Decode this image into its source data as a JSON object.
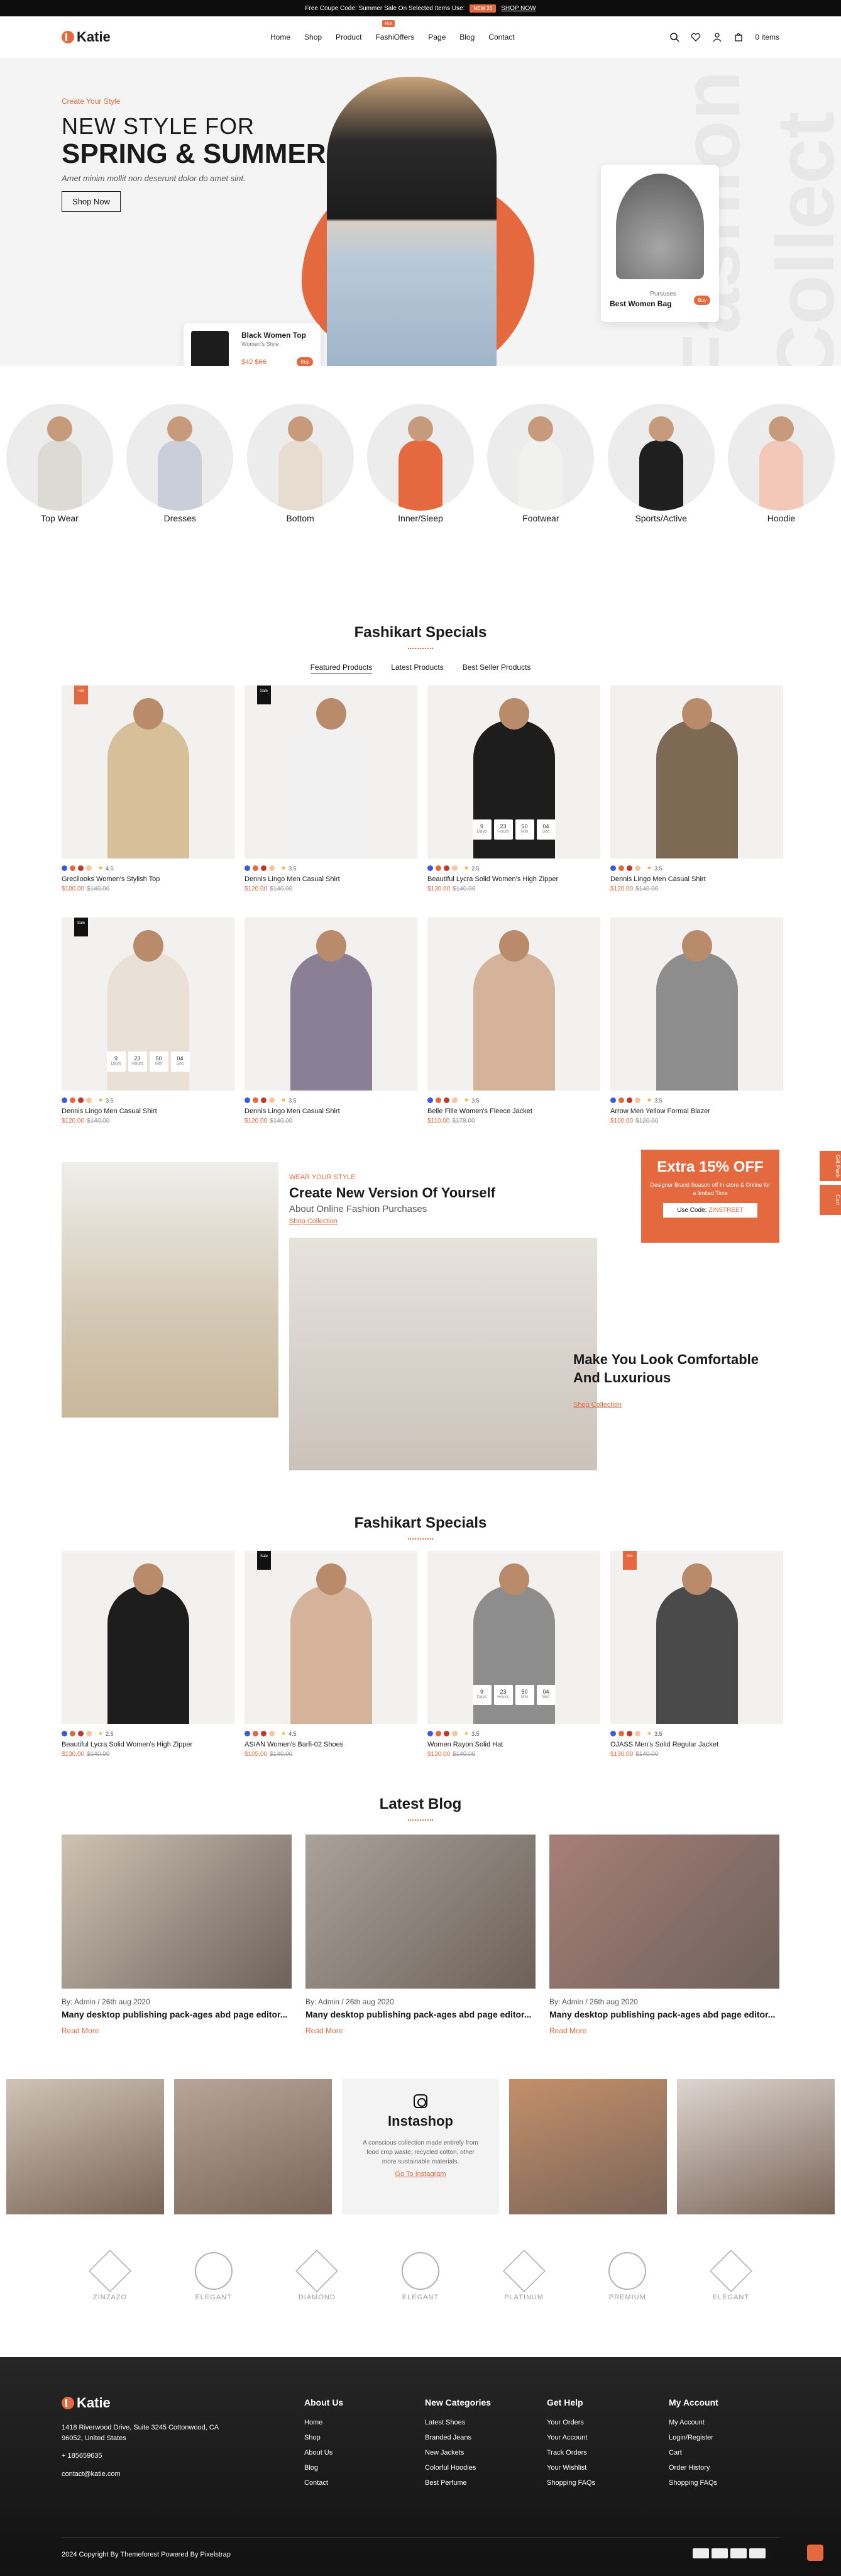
{
  "topbar": {
    "text": "Free Coupe Code: Summer Sale On Selected Items Use:",
    "tag": "NEW 26",
    "shop": "SHOP NOW"
  },
  "header": {
    "logo": "Katie",
    "nav": [
      "Home",
      "Shop",
      "Product",
      "FashiOffers",
      "Page",
      "Blog",
      "Contact"
    ],
    "hot": "Hot",
    "cart_label": "0 items"
  },
  "hero": {
    "eyebrow": "Create Your Style",
    "title1": "NEW STYLE FOR",
    "title2": "SPRING & SUMMER",
    "sub": "Amet minim mollit non deserunt dolor do amet sint.",
    "button": "Shop Now",
    "card1": {
      "title": "Black Women Top",
      "sub": "Women's Style",
      "price": "$42",
      "old": "$66",
      "btn": "Buy"
    },
    "card2": {
      "cat": "Pursuses",
      "title": "Best Women Bag",
      "btn": "Buy"
    },
    "bigtext": "Fashion Collect"
  },
  "categories": [
    {
      "label": "Top Wear",
      "color": "#dcdad5"
    },
    {
      "label": "Dresses",
      "color": "#c9ced9"
    },
    {
      "label": "Bottom",
      "color": "#e6ddd0"
    },
    {
      "label": "Inner/Sleep",
      "color": "#e4693e"
    },
    {
      "label": "Footwear",
      "color": "#f1f1ef"
    },
    {
      "label": "Sports/Active",
      "color": "#1f1f1f"
    },
    {
      "label": "Hoodie",
      "color": "#f3c8b8"
    }
  ],
  "specials": {
    "title": "Fashikart Specials",
    "tabs": [
      "Featured Products",
      "Latest Products",
      "Best Seller Products"
    ],
    "timer": [
      "9",
      "23",
      "50",
      "04"
    ],
    "timer_labels": [
      "Days",
      "Hours",
      "Min",
      "Sec"
    ],
    "products": [
      {
        "name": "Grecilooks Women's Stylish Top",
        "rating": "4.5",
        "price": "$100.00",
        "old": "$140.00",
        "badge": "Hot",
        "badge_dark": false,
        "color": "#d6bf99",
        "timer": false
      },
      {
        "name": "Dennis Lingo Men Casual Shirt",
        "rating": "3.5",
        "price": "$120.00",
        "old": "$140.00",
        "badge": "Sale",
        "badge_dark": true,
        "color": "#f1f1f1",
        "timer": false
      },
      {
        "name": "Beautiful Lycra Solid Women's High Zipper",
        "rating": "2.5",
        "price": "$130.00",
        "old": "$140.00",
        "badge": "",
        "badge_dark": false,
        "color": "#1d1d1d",
        "timer": true
      },
      {
        "name": "Dennis Lingo Men Casual Shirt",
        "rating": "3.5",
        "price": "$120.00",
        "old": "$140.00",
        "badge": "",
        "badge_dark": false,
        "color": "#7e6a54",
        "timer": false
      },
      {
        "name": "Dennis Lingo Men Casual Shirt",
        "rating": "3.5",
        "price": "$120.00",
        "old": "$140.00",
        "badge": "Sale",
        "badge_dark": true,
        "color": "#e9e1d6",
        "timer": true
      },
      {
        "name": "Dennis Lingo Men Casual Shirt",
        "rating": "3.5",
        "price": "$120.00",
        "old": "$140.00",
        "badge": "",
        "badge_dark": false,
        "color": "#8b7f95",
        "timer": false
      },
      {
        "name": "Belle Fille Women's Fleece Jacket",
        "rating": "3.5",
        "price": "$110.00",
        "old": "$178.00",
        "badge": "",
        "badge_dark": false,
        "color": "#d4b39a",
        "timer": false
      },
      {
        "name": "Arrow Men Yellow Formal Blazer",
        "rating": "3.5",
        "price": "$100.00",
        "old": "$120.00",
        "badge": "",
        "badge_dark": false,
        "color": "#8d8d8d",
        "timer": false
      }
    ]
  },
  "promo": {
    "wear": "WEAR YOUR STYLE",
    "heading": "Create New Version Of Yourself",
    "sub": "About Online Fashion Purchases",
    "link": "Shop Collection",
    "offer_title": "Extra 15% OFF",
    "offer_text": "Designer Brand Season off In-store & Online for a limited Time",
    "code_label": "Use Code:",
    "code": "ZINSTREET",
    "make": "Make You Look Comfortable And Luxurious",
    "link2": "Shop Collection",
    "side1": "Gift Pack",
    "side2": "Cart"
  },
  "specials2": {
    "title": "Fashikart Specials",
    "products": [
      {
        "name": "Beautiful Lycra Solid Women's High Zipper",
        "rating": "2.5",
        "price": "$130.00",
        "old": "$140.00",
        "badge": "",
        "badge_dark": false,
        "color": "#1d1d1d",
        "timer": false
      },
      {
        "name": "ASIAN Women's Barfi-02 Shoes",
        "rating": "4.5",
        "price": "$105.00",
        "old": "$140.00",
        "badge": "Sale",
        "badge_dark": true,
        "color": "#d4b39a",
        "timer": false
      },
      {
        "name": "Women Rayon Solid Hat",
        "rating": "3.5",
        "price": "$120.00",
        "old": "$140.00",
        "badge": "",
        "badge_dark": false,
        "color": "#8d8d8d",
        "timer": true
      },
      {
        "name": "OJASS Men's Solid Regular Jacket",
        "rating": "3.5",
        "price": "$130.00",
        "old": "$140.00",
        "badge": "Hot",
        "badge_dark": false,
        "color": "#4a4a4a",
        "timer": false
      }
    ]
  },
  "blog": {
    "title": "Latest Blog",
    "posts": [
      {
        "by": "By: Admin / 26th aug 2020",
        "title": "Many desktop publishing pack-ages abd page editor...",
        "read": "Read More",
        "color": "#cfc2b4"
      },
      {
        "by": "By: Admin / 26th aug 2020",
        "title": "Many desktop publishing pack-ages abd page editor...",
        "read": "Read More",
        "color": "#a9a29b"
      },
      {
        "by": "By: Admin / 26th aug 2020",
        "title": "Many desktop publishing pack-ages abd page editor...",
        "read": "Read More",
        "color": "#a77e78"
      }
    ]
  },
  "insta": {
    "title": "Instashop",
    "desc": "A conscious collection made entirely from food crop waste, recycled cotton, other more sustainable materials.",
    "link": "Go To Instagram",
    "photos": [
      "#cfc4b6",
      "#b9a49a",
      "#c48f6a",
      "#ddd6d0"
    ]
  },
  "brands": [
    "ZINZAZO",
    "ELEGANT",
    "DIAMOND",
    "ELEGANT",
    "PLATINUM",
    "PREMIUM",
    "ELEGANT"
  ],
  "footer": {
    "logo": "Katie",
    "address": "1418 Riverwood Drive, Suite 3245 Cottonwood, CA 96052, United States",
    "phone": "+ 185659635",
    "email": "contact@katie.com",
    "cols": [
      {
        "title": "About Us",
        "items": [
          "Home",
          "Shop",
          "About Us",
          "Blog",
          "Contact"
        ]
      },
      {
        "title": "New Categories",
        "items": [
          "Latest Shoes",
          "Branded Jeans",
          "New Jackets",
          "Colorful Hoodies",
          "Best Perfume"
        ]
      },
      {
        "title": "Get Help",
        "items": [
          "Your Orders",
          "Your Account",
          "Track Orders",
          "Your Wishlist",
          "Shopping FAQs"
        ]
      },
      {
        "title": "My Account",
        "items": [
          "My Account",
          "Login/Register",
          "Cart",
          "Order History",
          "Shopping FAQs"
        ]
      }
    ],
    "copyright": "2024 Copyright By Themeforest Powered By Pixelstrap"
  }
}
